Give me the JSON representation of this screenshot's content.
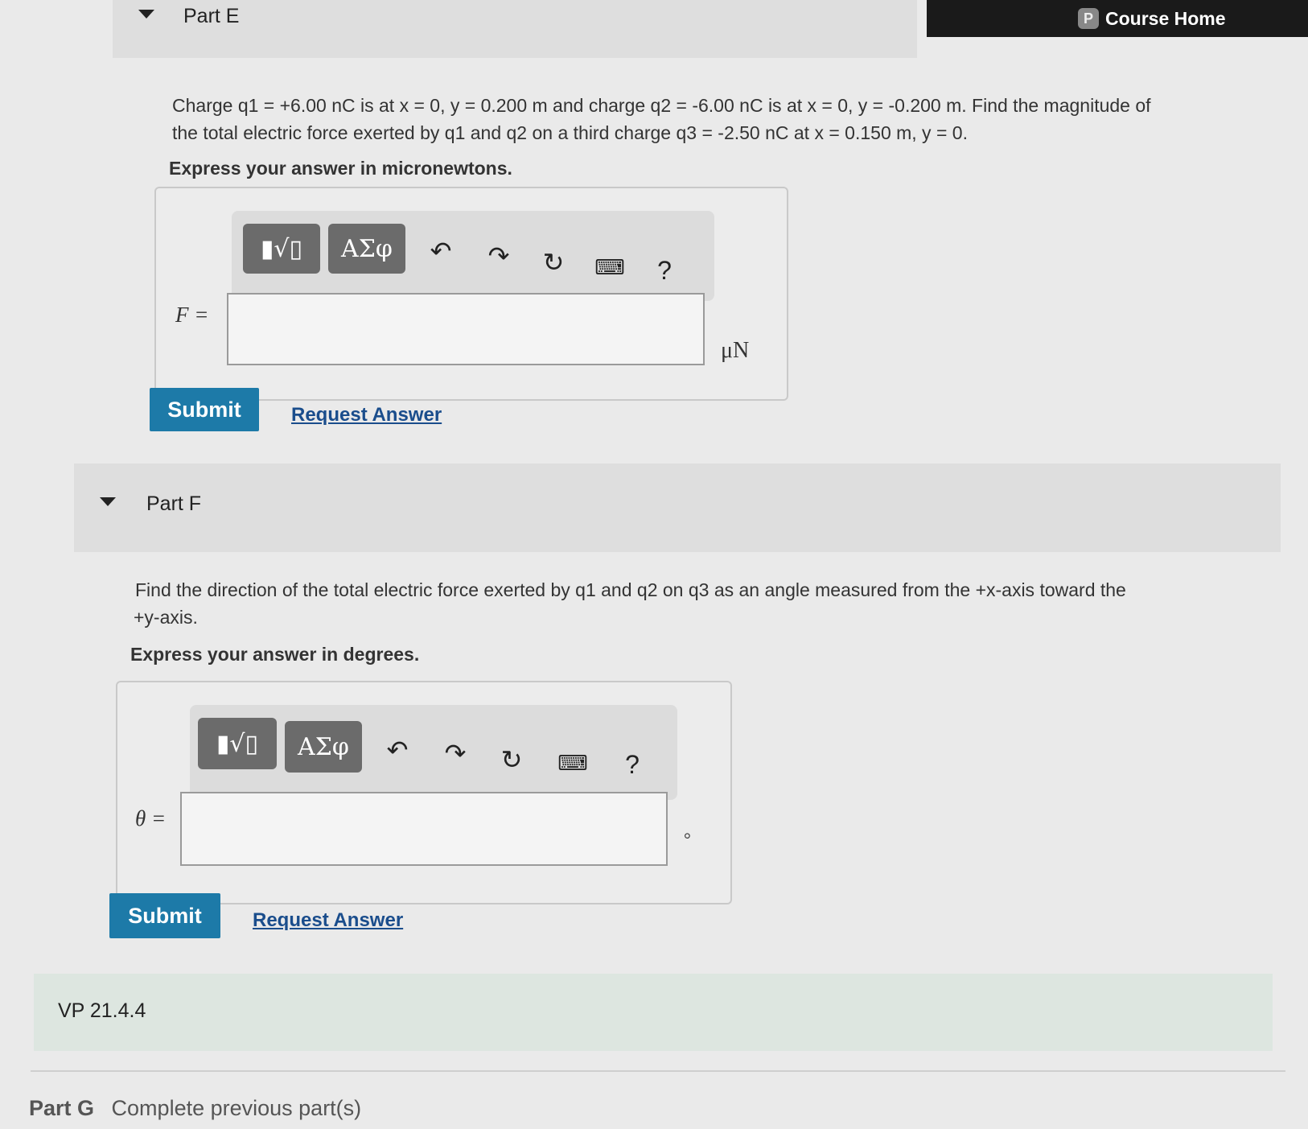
{
  "header": {
    "badge": "P",
    "course_home": "Course Home"
  },
  "part_e": {
    "title": "Part E",
    "question_line1": "Charge q1 = +6.00 nC is at x = 0, y = 0.200 m and charge q2 = -6.00 nC is at x = 0, y = -0.200 m. Find the magnitude of",
    "question_line2": "the total electric force exerted by q1 and q2 on a third charge q3 = -2.50 nC at x = 0.150 m, y = 0.",
    "express": "Express your answer in micronewtons.",
    "toolbar": {
      "templates": "▮√▯",
      "greek": "ΑΣφ",
      "help": "?"
    },
    "variable": "F =",
    "input_value": "",
    "unit": "μN",
    "submit": "Submit",
    "request": "Request Answer"
  },
  "part_f": {
    "title": "Part F",
    "question_line1": "Find the direction of the total electric force exerted by q1 and q2 on q3 as an angle measured from the +x-axis toward the",
    "question_line2": "+y-axis.",
    "express": "Express your answer in degrees.",
    "toolbar": {
      "templates": "▮√▯",
      "greek": "ΑΣφ",
      "help": "?"
    },
    "variable": "θ =",
    "input_value": "",
    "unit": "°",
    "submit": "Submit",
    "request": "Request Answer"
  },
  "vp": {
    "title": "VP 21.4.4"
  },
  "part_g": {
    "title": "Part G",
    "status": "Complete previous part(s)"
  }
}
